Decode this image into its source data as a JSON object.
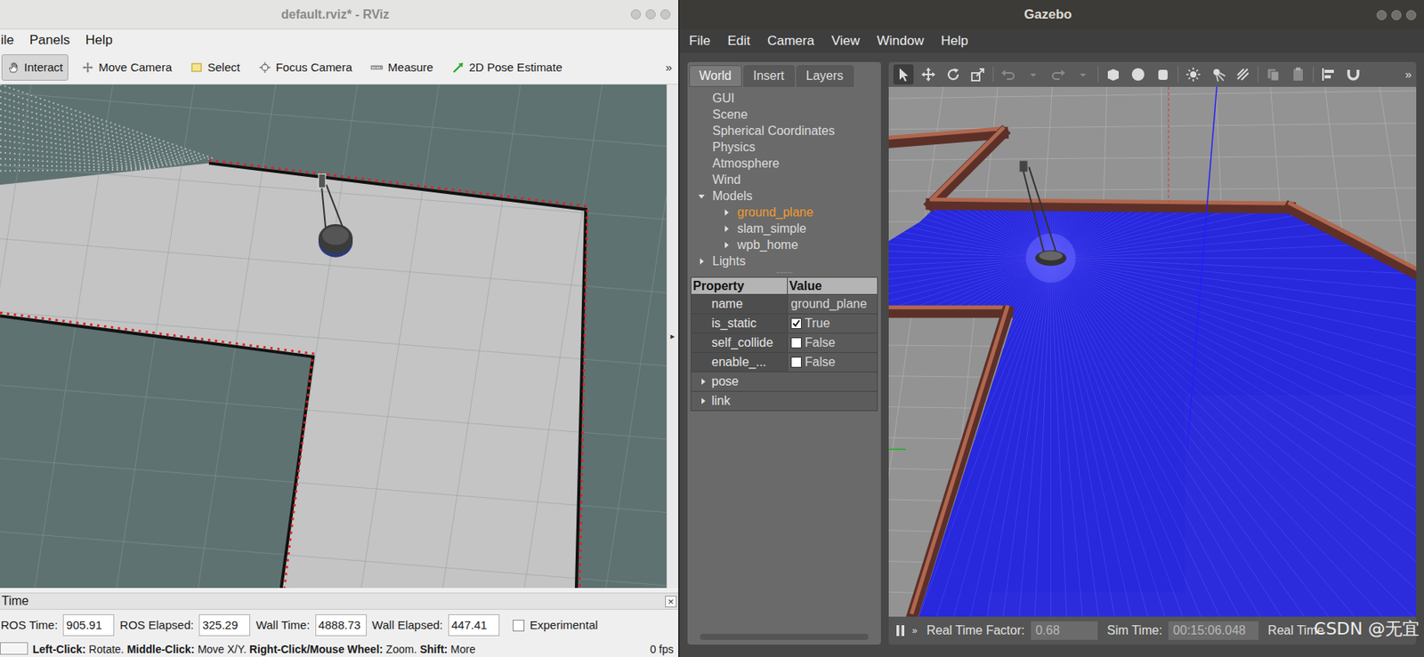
{
  "rviz": {
    "title": "default.rviz* - RViz",
    "menu": [
      "ile",
      "Panels",
      "Help"
    ],
    "tools": [
      {
        "label": "Interact",
        "selected": true
      },
      {
        "label": "Move Camera",
        "selected": false
      },
      {
        "label": "Select",
        "selected": false
      },
      {
        "label": "Focus Camera",
        "selected": false
      },
      {
        "label": "Measure",
        "selected": false
      },
      {
        "label": "2D Pose Estimate",
        "selected": false
      }
    ],
    "toolbar_more": "»",
    "side_arrow": "▸",
    "time_panel": {
      "title": "Time",
      "close": "×",
      "fields": [
        {
          "label": "ROS Time:",
          "value": "905.91"
        },
        {
          "label": "ROS Elapsed:",
          "value": "325.29"
        },
        {
          "label": "Wall Time:",
          "value": "4888.73"
        },
        {
          "label": "Wall Elapsed:",
          "value": "447.41"
        }
      ],
      "experimental": {
        "label": "Experimental",
        "checked": false
      }
    },
    "status_bar": {
      "hint_parts": [
        {
          "text": "Left-Click:",
          "bold": true
        },
        {
          "text": " Rotate. ",
          "bold": false
        },
        {
          "text": "Middle-Click:",
          "bold": true
        },
        {
          "text": " Move X/Y. ",
          "bold": false
        },
        {
          "text": "Right-Click/Mouse Wheel:",
          "bold": true
        },
        {
          "text": " Zoom. ",
          "bold": false
        },
        {
          "text": "Shift:",
          "bold": true
        },
        {
          "text": " More",
          "bold": false
        }
      ],
      "fps": "0 fps"
    }
  },
  "gazebo": {
    "title": "Gazebo",
    "menu": [
      "File",
      "Edit",
      "Camera",
      "View",
      "Window",
      "Help"
    ],
    "tabs": [
      {
        "label": "World",
        "selected": true
      },
      {
        "label": "Insert",
        "selected": false
      },
      {
        "label": "Layers",
        "selected": false
      }
    ],
    "tree": [
      {
        "label": "GUI",
        "depth": 0,
        "kind": "leaf",
        "selected": false
      },
      {
        "label": "Scene",
        "depth": 0,
        "kind": "leaf",
        "selected": false
      },
      {
        "label": "Spherical Coordinates",
        "depth": 0,
        "kind": "leaf",
        "selected": false
      },
      {
        "label": "Physics",
        "depth": 0,
        "kind": "leaf",
        "selected": false
      },
      {
        "label": "Atmosphere",
        "depth": 0,
        "kind": "leaf",
        "selected": false
      },
      {
        "label": "Wind",
        "depth": 0,
        "kind": "leaf",
        "selected": false
      },
      {
        "label": "Models",
        "depth": 0,
        "kind": "branch",
        "expanded": true,
        "selected": false
      },
      {
        "label": "ground_plane",
        "depth": 1,
        "kind": "branch",
        "expanded": false,
        "selected": true
      },
      {
        "label": "slam_simple",
        "depth": 1,
        "kind": "branch",
        "expanded": false,
        "selected": false
      },
      {
        "label": "wpb_home",
        "depth": 1,
        "kind": "branch",
        "expanded": false,
        "selected": false
      },
      {
        "label": "Lights",
        "depth": 0,
        "kind": "branch",
        "expanded": false,
        "selected": false
      }
    ],
    "properties": {
      "header": [
        "Property",
        "Value"
      ],
      "rows": [
        {
          "kind": "text",
          "name": "name",
          "value": "ground_plane"
        },
        {
          "kind": "check",
          "name": "is_static",
          "checked": true,
          "value": "True"
        },
        {
          "kind": "check",
          "name": "self_collide",
          "checked": false,
          "value": "False"
        },
        {
          "kind": "check",
          "name": "enable_...",
          "checked": false,
          "value": "False"
        },
        {
          "kind": "group",
          "name": "pose"
        },
        {
          "kind": "group",
          "name": "link"
        }
      ]
    },
    "toolbar_more": "»",
    "bottom_bar": {
      "more": "»",
      "fields": [
        {
          "label": "Real Time Factor:",
          "value": "0.68"
        },
        {
          "label": "Sim Time:",
          "value": "00:15:06.048"
        }
      ],
      "cut_label": "Real Time"
    },
    "watermark": "CSDN @无宜"
  }
}
